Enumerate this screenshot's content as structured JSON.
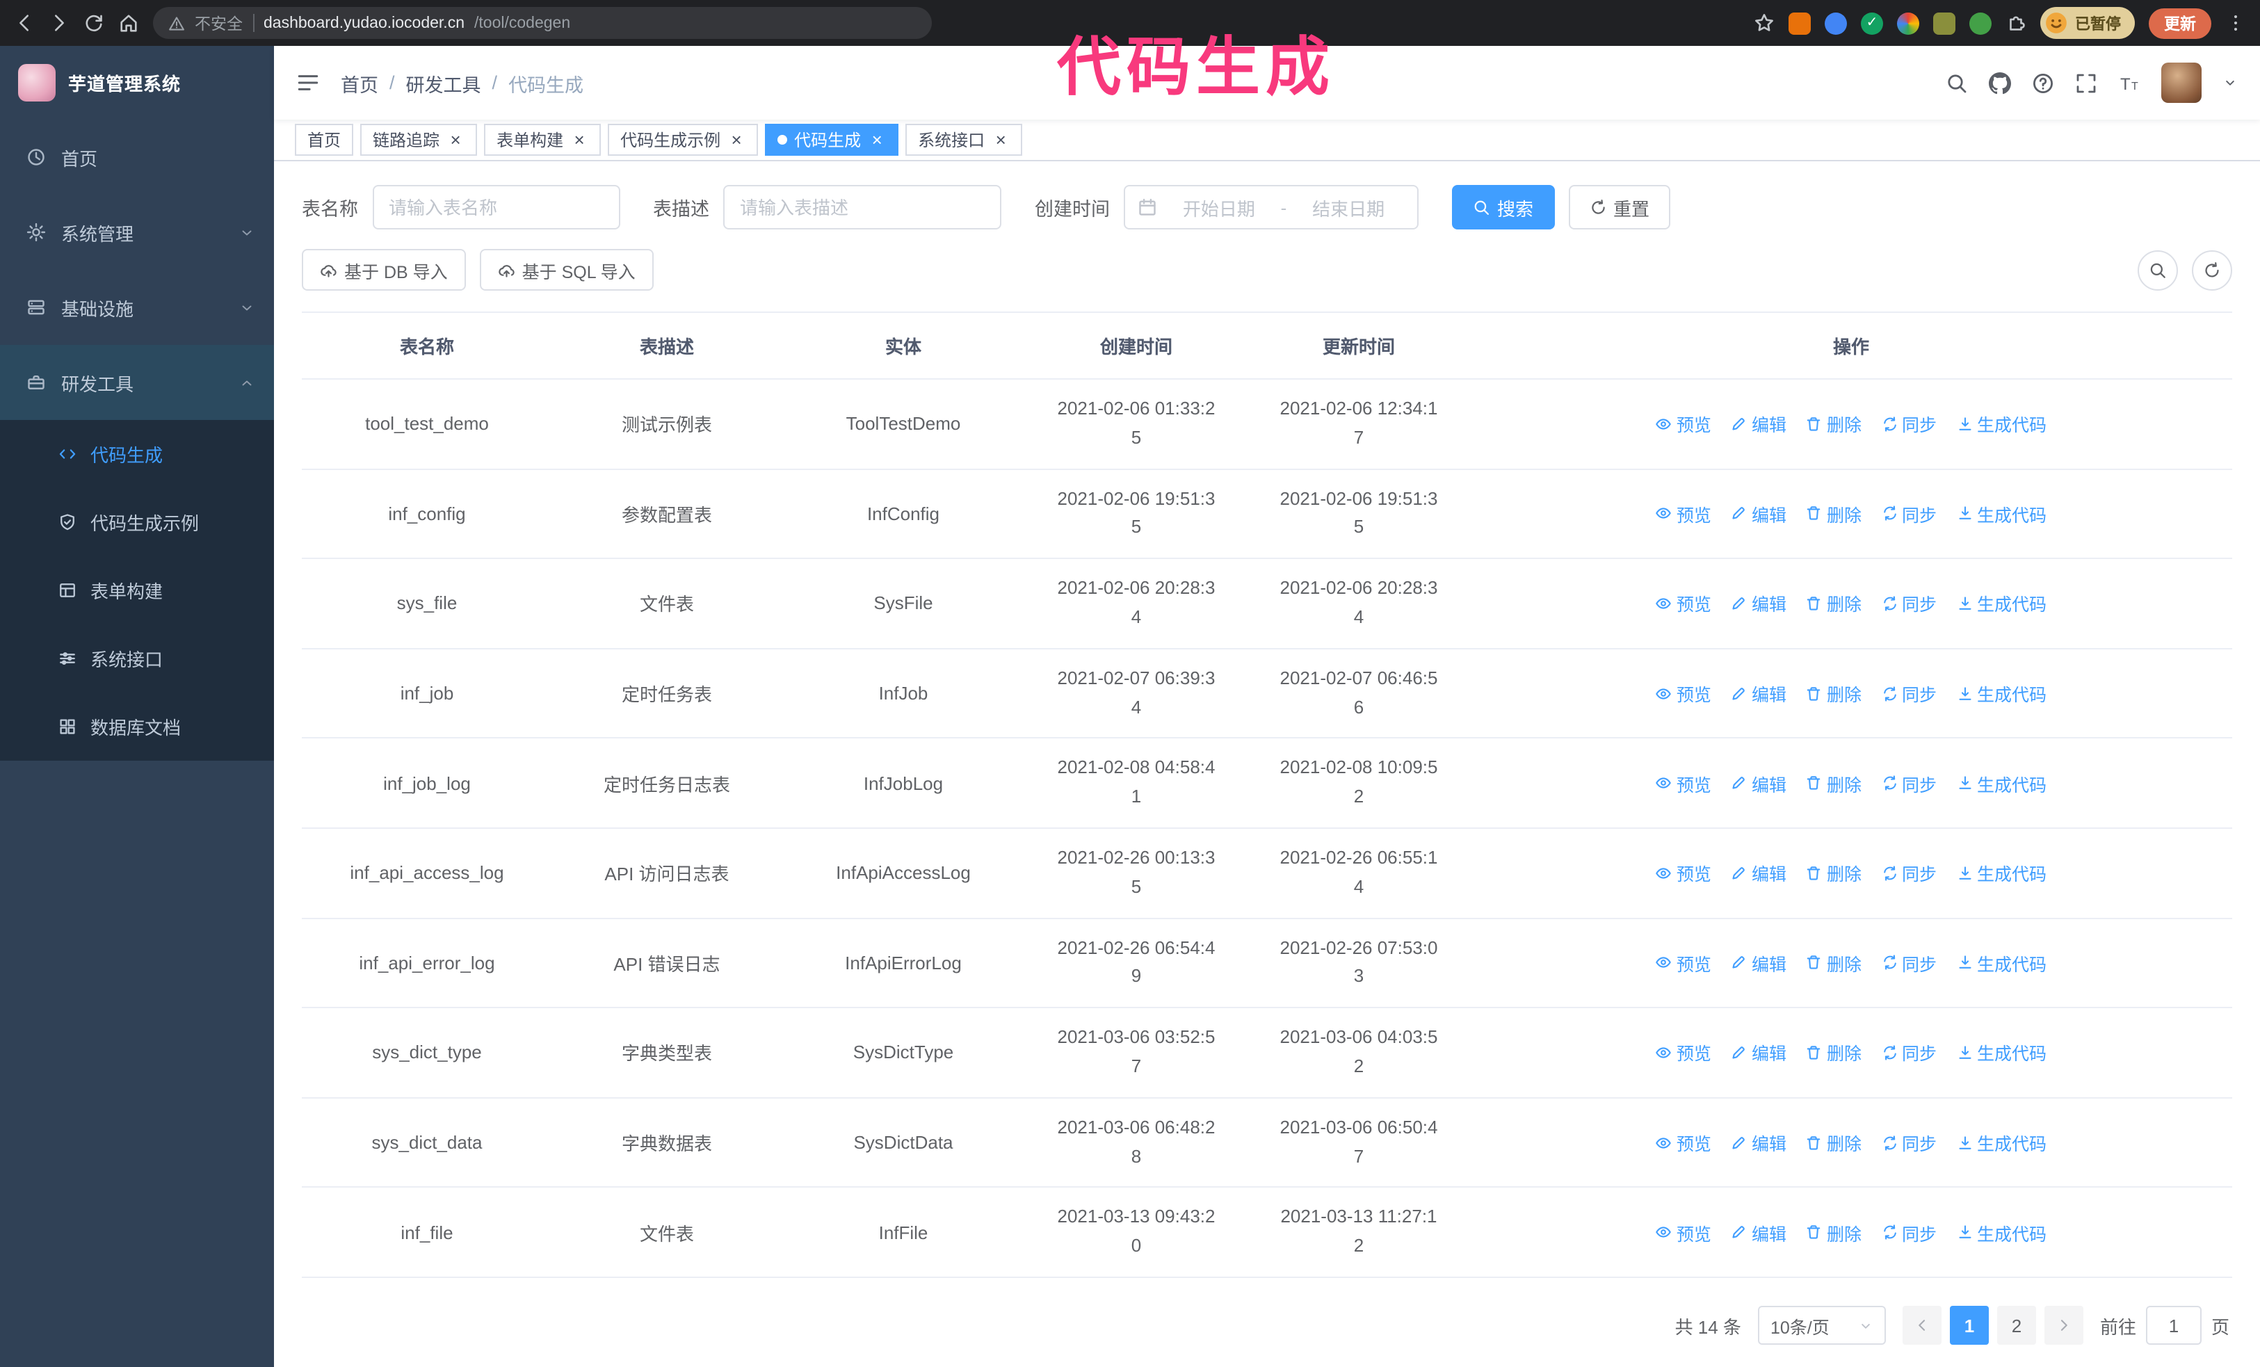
{
  "browser": {
    "security_label": "不安全",
    "url_domain": "dashboard.yudao.iocoder.cn",
    "url_path": "/tool/codegen",
    "paused_badge": "已暂停",
    "update_button": "更新"
  },
  "annotation": {
    "text": "代码生成",
    "color": "#f8397d"
  },
  "theme": {
    "primary": "#409eff",
    "sidebar_bg": "#304156",
    "submenu_bg": "#1f2d3d"
  },
  "sidebar": {
    "logo_title": "芋道管理系统",
    "items": [
      {
        "id": "home",
        "label": "首页",
        "icon": "dashboard-icon"
      },
      {
        "id": "system",
        "label": "系统管理",
        "icon": "gear-icon",
        "chevron": "down"
      },
      {
        "id": "infra",
        "label": "基础设施",
        "icon": "server-icon",
        "chevron": "down"
      },
      {
        "id": "devtools",
        "label": "研发工具",
        "icon": "toolbox-icon",
        "chevron": "up",
        "expanded": true
      }
    ],
    "sub_items": [
      {
        "id": "codegen",
        "label": "代码生成",
        "icon": "code-icon",
        "active": true
      },
      {
        "id": "codegen-example",
        "label": "代码生成示例",
        "icon": "badge-icon"
      },
      {
        "id": "form-builder",
        "label": "表单构建",
        "icon": "form-icon"
      },
      {
        "id": "api",
        "label": "系统接口",
        "icon": "api-icon"
      },
      {
        "id": "db-doc",
        "label": "数据库文档",
        "icon": "database-icon"
      }
    ]
  },
  "header": {
    "breadcrumb": [
      "首页",
      "研发工具",
      "代码生成"
    ],
    "separator": "/"
  },
  "tabs": [
    {
      "id": "home",
      "label": "首页",
      "closable": false
    },
    {
      "id": "tracer",
      "label": "链路追踪",
      "closable": true
    },
    {
      "id": "form-builder",
      "label": "表单构建",
      "closable": true
    },
    {
      "id": "codegen-example",
      "label": "代码生成示例",
      "closable": true
    },
    {
      "id": "codegen",
      "label": "代码生成",
      "closable": true,
      "active": true
    },
    {
      "id": "api",
      "label": "系统接口",
      "closable": true
    }
  ],
  "filters": {
    "table_name_label": "表名称",
    "table_name_placeholder": "请输入表名称",
    "table_desc_label": "表描述",
    "table_desc_placeholder": "请输入表描述",
    "create_time_label": "创建时间",
    "date_start_placeholder": "开始日期",
    "date_separator": "-",
    "date_end_placeholder": "结束日期",
    "search_button": "搜索",
    "reset_button": "重置"
  },
  "toolbar": {
    "import_db_button": "基于 DB 导入",
    "import_sql_button": "基于 SQL 导入"
  },
  "table": {
    "columns": [
      "表名称",
      "表描述",
      "实体",
      "创建时间",
      "更新时间",
      "操作"
    ],
    "actions": [
      {
        "id": "preview",
        "label": "预览",
        "icon": "eye-icon"
      },
      {
        "id": "edit",
        "label": "编辑",
        "icon": "edit-icon"
      },
      {
        "id": "delete",
        "label": "删除",
        "icon": "delete-icon"
      },
      {
        "id": "sync",
        "label": "同步",
        "icon": "sync-icon"
      },
      {
        "id": "generate",
        "label": "生成代码",
        "icon": "download-icon"
      }
    ],
    "rows": [
      {
        "name": "tool_test_demo",
        "desc": "测试示例表",
        "entity": "ToolTestDemo",
        "created": "2021-02-06 01:33:25",
        "updated": "2021-02-06 12:34:17"
      },
      {
        "name": "inf_config",
        "desc": "参数配置表",
        "entity": "InfConfig",
        "created": "2021-02-06 19:51:35",
        "updated": "2021-02-06 19:51:35"
      },
      {
        "name": "sys_file",
        "desc": "文件表",
        "entity": "SysFile",
        "created": "2021-02-06 20:28:34",
        "updated": "2021-02-06 20:28:34"
      },
      {
        "name": "inf_job",
        "desc": "定时任务表",
        "entity": "InfJob",
        "created": "2021-02-07 06:39:34",
        "updated": "2021-02-07 06:46:56"
      },
      {
        "name": "inf_job_log",
        "desc": "定时任务日志表",
        "entity": "InfJobLog",
        "created": "2021-02-08 04:58:41",
        "updated": "2021-02-08 10:09:52"
      },
      {
        "name": "inf_api_access_log",
        "desc": "API 访问日志表",
        "entity": "InfApiAccessLog",
        "created": "2021-02-26 00:13:35",
        "updated": "2021-02-26 06:55:14"
      },
      {
        "name": "inf_api_error_log",
        "desc": "API 错误日志",
        "entity": "InfApiErrorLog",
        "created": "2021-02-26 06:54:49",
        "updated": "2021-02-26 07:53:03"
      },
      {
        "name": "sys_dict_type",
        "desc": "字典类型表",
        "entity": "SysDictType",
        "created": "2021-03-06 03:52:57",
        "updated": "2021-03-06 04:03:52"
      },
      {
        "name": "sys_dict_data",
        "desc": "字典数据表",
        "entity": "SysDictData",
        "created": "2021-03-06 06:48:28",
        "updated": "2021-03-06 06:50:47"
      },
      {
        "name": "inf_file",
        "desc": "文件表",
        "entity": "InfFile",
        "created": "2021-03-13 09:43:20",
        "updated": "2021-03-13 11:27:12"
      }
    ]
  },
  "pagination": {
    "total": "共 14 条",
    "page_size": "10条/页",
    "pages": [
      "1",
      "2"
    ],
    "active_page": "1",
    "goto_label": "前往",
    "goto_value": "1",
    "goto_suffix": "页"
  }
}
